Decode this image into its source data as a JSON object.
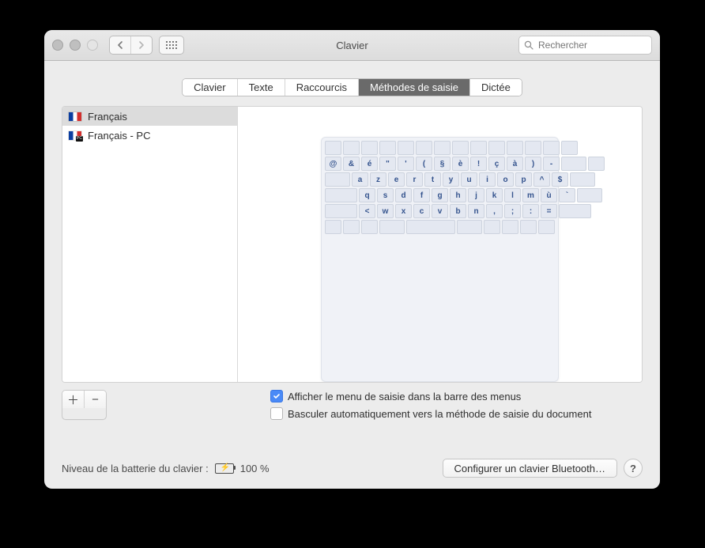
{
  "window": {
    "title": "Clavier",
    "search_placeholder": "Rechercher"
  },
  "tabs": [
    {
      "label": "Clavier",
      "selected": false
    },
    {
      "label": "Texte",
      "selected": false
    },
    {
      "label": "Raccourcis",
      "selected": false
    },
    {
      "label": "Méthodes de saisie",
      "selected": true
    },
    {
      "label": "Dictée",
      "selected": false
    }
  ],
  "input_sources": [
    {
      "label": "Français",
      "flag": "fr",
      "selected": true
    },
    {
      "label": "Français - PC",
      "flag": "frpc",
      "selected": false
    }
  ],
  "keyboard_rows": [
    {
      "type": "fn",
      "keys": [
        "",
        "",
        "",
        "",
        "",
        "",
        "",
        "",
        "",
        "",
        "",
        "",
        "",
        ""
      ]
    },
    {
      "type": "num",
      "keys": [
        "@",
        "&",
        "é",
        "\"",
        "'",
        "(",
        "§",
        "è",
        "!",
        "ç",
        "à",
        ")",
        "-"
      ],
      "trail_wide": true
    },
    {
      "type": "top",
      "lead_wide": true,
      "keys": [
        "a",
        "z",
        "e",
        "r",
        "t",
        "y",
        "u",
        "i",
        "o",
        "p",
        "^",
        "$"
      ],
      "trail_wide": true
    },
    {
      "type": "home",
      "lead_wider": true,
      "keys": [
        "q",
        "s",
        "d",
        "f",
        "g",
        "h",
        "j",
        "k",
        "l",
        "m",
        "ù",
        "`"
      ]
    },
    {
      "type": "bot",
      "lead_wider": true,
      "keys": [
        "<",
        "w",
        "x",
        "c",
        "v",
        "b",
        "n",
        ",",
        ";",
        ":",
        "="
      ],
      "trail_wider": true
    },
    {
      "type": "mod",
      "keys": []
    }
  ],
  "options": {
    "show_menu": {
      "label": "Afficher le menu de saisie dans la barre des menus",
      "checked": true
    },
    "auto_switch": {
      "label": "Basculer automatiquement vers la méthode de saisie du document",
      "checked": false
    }
  },
  "footer": {
    "battery_label": "Niveau de la batterie du clavier :",
    "battery_value": "100 %",
    "configure_bt": "Configurer un clavier Bluetooth…",
    "help": "?"
  },
  "icons": {
    "add": "＋",
    "remove": "−"
  }
}
